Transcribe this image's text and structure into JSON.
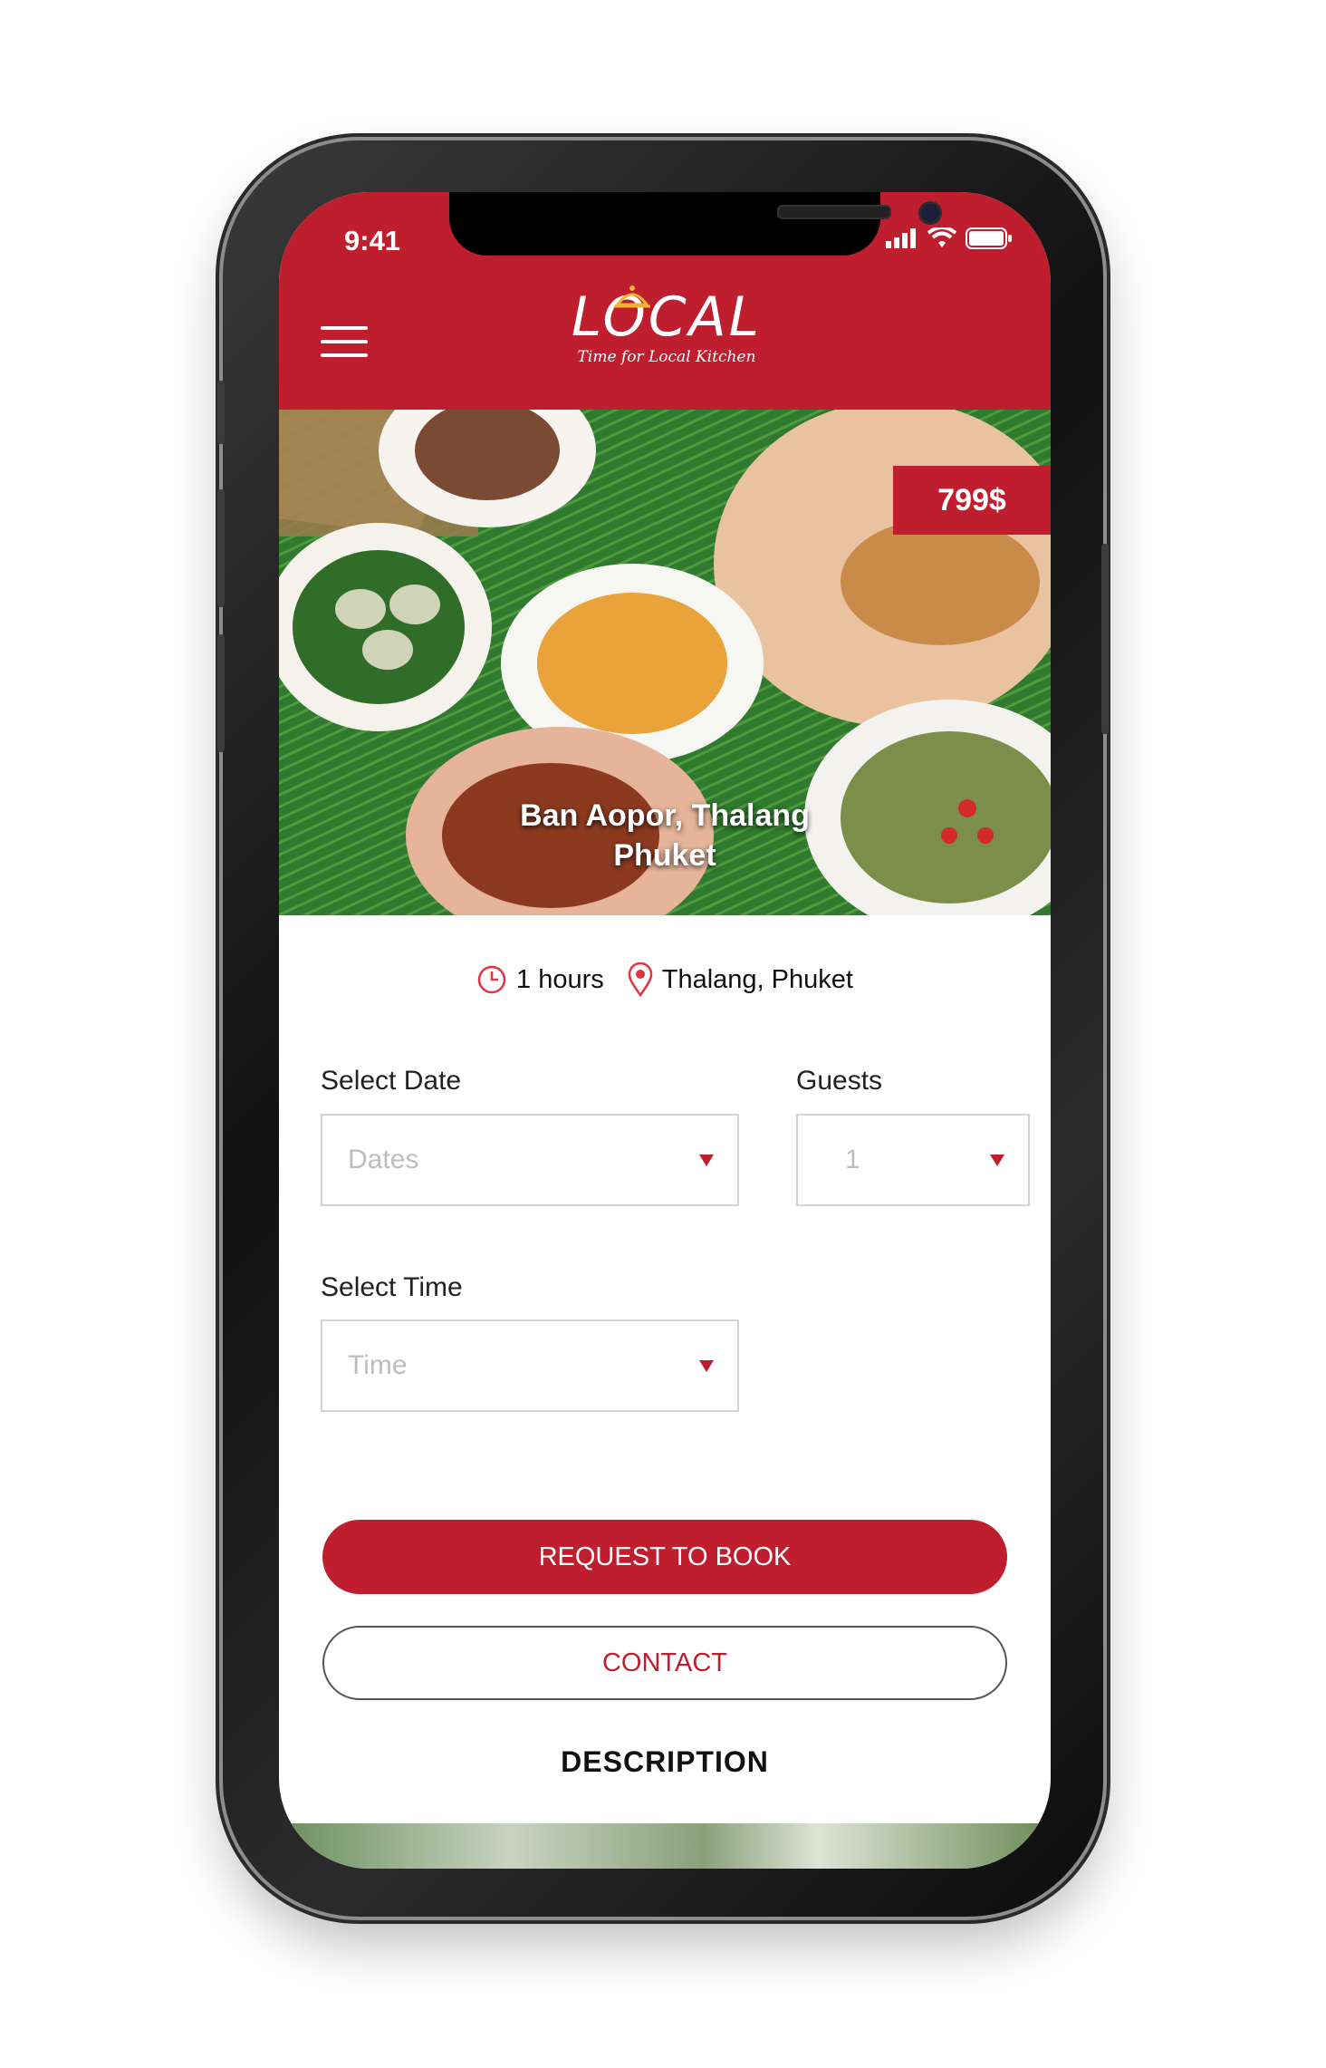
{
  "status_bar": {
    "time": "9:41"
  },
  "header": {
    "logo_text": "LOCAL",
    "logo_tagline": "Time for Local Kitchen",
    "brand_color": "#bf1e2e"
  },
  "hero": {
    "price": "799$",
    "title_line1": "Ban Aopor, Thalang",
    "title_line2": "Phuket"
  },
  "meta": {
    "duration": "1 hours",
    "location": "Thalang, Phuket"
  },
  "form": {
    "date_label": "Select Date",
    "date_value": "Dates",
    "guests_label": "Guests",
    "guests_value": "1",
    "time_label": "Select Time",
    "time_value": "Time"
  },
  "actions": {
    "book_label": "REQUEST TO BOOK",
    "contact_label": "CONTACT"
  },
  "section": {
    "title": "DESCRIPTION"
  }
}
